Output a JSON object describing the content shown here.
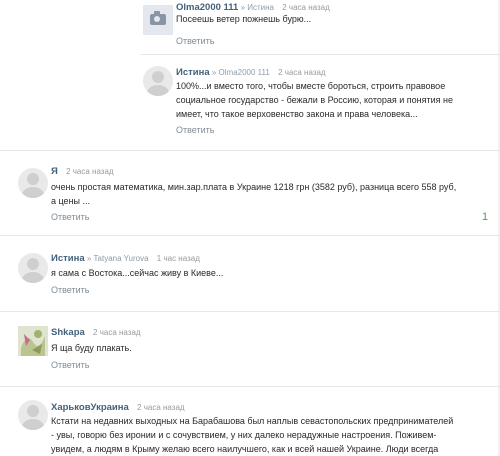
{
  "comments": [
    {
      "name": "Olma2000 111",
      "reply_to": "» Истина",
      "time": "2 часа назад",
      "text": "Посеешь ветер пожнешь бурю...",
      "reply": "Ответить"
    },
    {
      "name": "Истина",
      "reply_to": "» Olma2000 111",
      "time": "2 часа назад",
      "text_lines": [
        "100%...и вместо того, чтобы вместе бороться, строить правовое",
        "социальное государство - бежали в Россию, которая и понятия не",
        "имеет, что такое верховенство закона и права человека..."
      ],
      "reply": "Ответить"
    },
    {
      "name": "Я",
      "time": "2 часа назад",
      "text_lines": [
        "очень простая математика, мин.зар.плата в Украине 1218 грн (3582 руб), разница всего 558 руб,",
        "а цены ..."
      ],
      "reply": "Ответить",
      "count": "1"
    },
    {
      "name": "Истина",
      "reply_to": "» Tatyana Yurova",
      "time": "1 час назад",
      "text": "я сама с Востока...сейчас живу в Киеве...",
      "reply": "Ответить"
    },
    {
      "name": "Shkapa",
      "time": "2 часа назад",
      "text": "Я ща буду плакать.",
      "reply": "Ответить"
    },
    {
      "name": "ХарьковУкраина",
      "time": "2 часа назад",
      "text_lines": [
        "Кстати на недавних выходных на Барабашова был наплыв севастопольских предпринимателей",
        "- увы, говорю без иронии и с сочувствием, у них далеко нерадужные настроения. Поживем-",
        "увидем, а людям в Крыму желаю всего наилучшего, как и всей нашей Украине. Люди всегда"
      ]
    }
  ]
}
